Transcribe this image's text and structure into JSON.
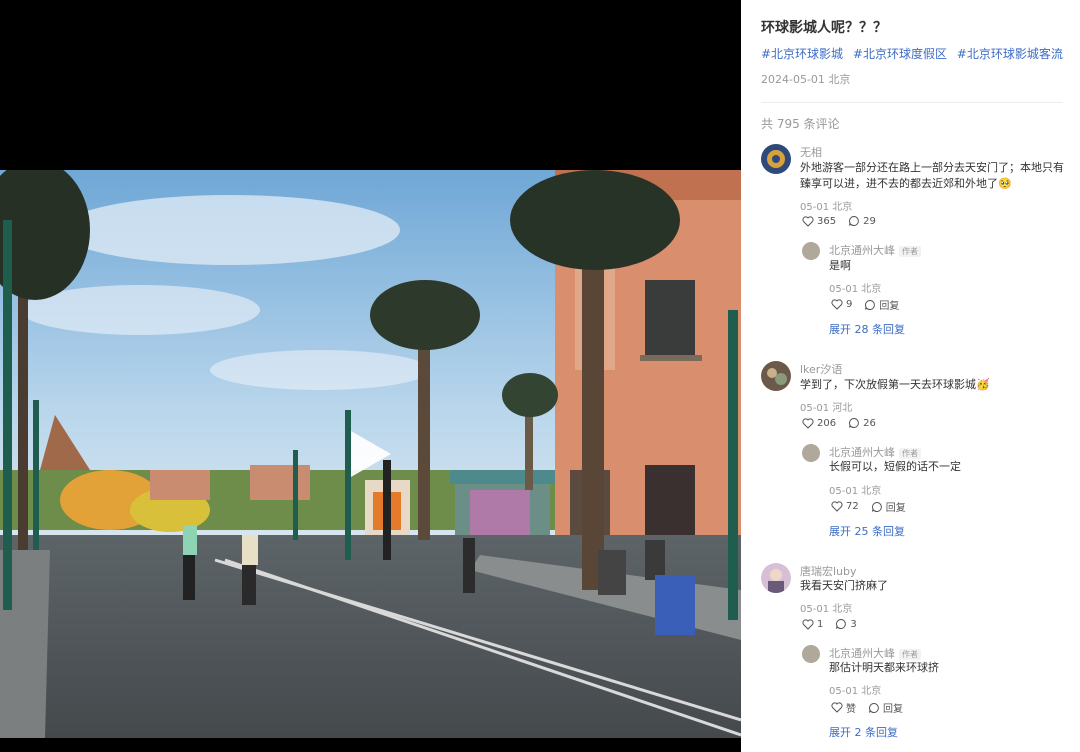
{
  "post": {
    "title": "环球影城人呢？？？",
    "tags": [
      "#北京环球影城",
      "#北京环球度假区",
      "#北京环球影城客流"
    ],
    "meta": "2024-05-01 北京"
  },
  "comments_header": {
    "count_text": "共 795 条评论"
  },
  "comments": [
    {
      "user": "无相",
      "text_l1": "外地游客一部分还在路上一部分去天安门了；本地只有",
      "text_l2": "臻享可以进，进不去的都去近郊和外地了🥺",
      "meta": "05-01 北京",
      "likes": "365",
      "replies": "29",
      "reply": {
        "user": "北京通州大峰",
        "badge": "作者",
        "text": "是啊",
        "meta": "05-01 北京",
        "likes": "9",
        "reply_label": "回复"
      },
      "expand": "展开 28 条回复"
    },
    {
      "user": "lker汐语",
      "text_l1": "学到了，下次放假第一天去环球影城🥳",
      "meta": "05-01 河北",
      "likes": "206",
      "replies": "26",
      "reply": {
        "user": "北京通州大峰",
        "badge": "作者",
        "text": "长假可以，短假的话不一定",
        "meta": "05-01 北京",
        "likes": "72",
        "reply_label": "回复"
      },
      "expand": "展开 25 条回复"
    },
    {
      "user": "唐瑞宏luby",
      "text_l1": "我看天安门挤麻了",
      "meta": "05-01 北京",
      "likes": "1",
      "replies": "3",
      "reply": {
        "user": "北京通州大峰",
        "badge": "作者",
        "text": "那估计明天都来环球挤",
        "meta": "05-01 北京",
        "likes": "赞",
        "reply_label": "回复"
      },
      "expand": "展开 2 条回复"
    }
  ],
  "colors": {
    "link": "#3d6cc4",
    "muted": "#999999",
    "text": "#333333"
  },
  "icons": {
    "like": "heart-icon",
    "comment": "comment-bubble-icon",
    "play": "play-icon"
  }
}
